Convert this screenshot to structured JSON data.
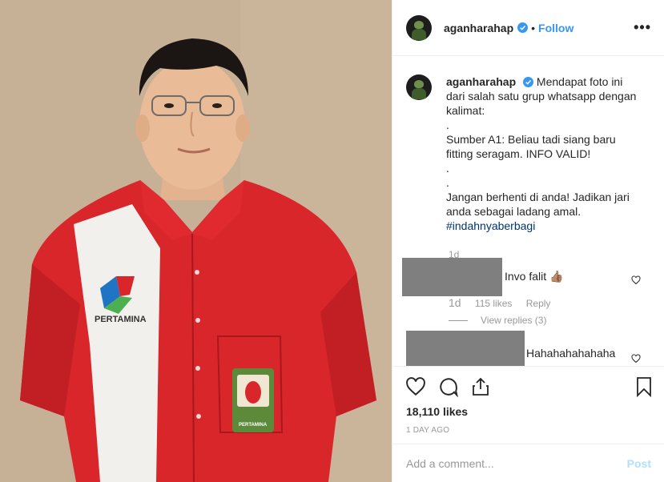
{
  "post": {
    "username": "aganharahap",
    "follow_label": "Follow",
    "separator": "•",
    "more_label": "•••",
    "caption": {
      "username": "aganharahap",
      "lines": [
        "Mendapat foto ini",
        "dari salah satu grup whatsapp dengan",
        "kalimat:",
        ".",
        "Sumber A1: Beliau tadi siang baru",
        "fitting seragam. INFO VALID!",
        ".",
        ".",
        "Jangan berhenti di anda! Jadikan jari",
        "anda sebagai ladang amal."
      ],
      "hashtag": "#indahnyaberbagi",
      "time": "1d"
    },
    "comments": [
      {
        "text": "Invo falit 👍🏽",
        "time": "1d",
        "likes": "115 likes",
        "reply_label": "Reply",
        "view_replies": "View replies (3)"
      },
      {
        "text": "Hahahahahahaha"
      }
    ],
    "likes_count": "18,110 likes",
    "date": "1 DAY AGO",
    "comment_placeholder": "Add a comment...",
    "post_label": "Post"
  },
  "photo": {
    "shirt_logo_text": "PERTAMINA",
    "patch_text": "PERTAMINA"
  },
  "colors": {
    "accent": "#3897f0",
    "shirt_red": "#d8262b",
    "background": "#c4af95",
    "hashtag": "#003569"
  },
  "icons": [
    "verified-badge-icon",
    "heart-icon",
    "comment-icon",
    "share-icon",
    "bookmark-icon",
    "more-icon"
  ]
}
